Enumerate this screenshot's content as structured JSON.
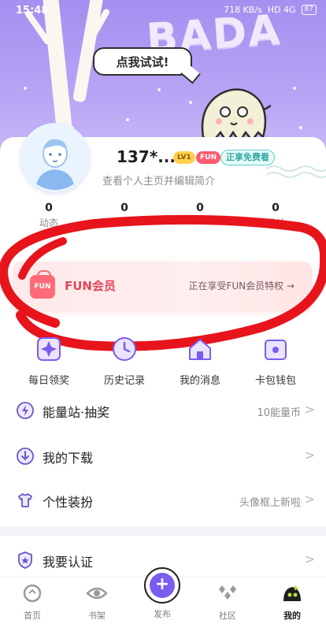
{
  "status_bar": {
    "time": "15:48",
    "net_speed": "718 KB/s",
    "signal": "HD 4G",
    "battery": "87"
  },
  "banner": {
    "bubble_text": "点我试试!",
    "brand_text": "BADA",
    "accent": "#a58ff0"
  },
  "profile": {
    "name": "137*...",
    "level_badge": "LV1",
    "fun_badge": "FUN",
    "free_tag": "正享免费看",
    "subtitle": "查看个人主页并编辑简介"
  },
  "stats": [
    {
      "value": "0",
      "label": "动态"
    },
    {
      "value": "0",
      "label": ""
    },
    {
      "value": "0",
      "label": ""
    },
    {
      "value": "0",
      "label": "粉丝"
    }
  ],
  "member": {
    "logo": "FUN",
    "title": "FUN会员",
    "desc": "正在享受FUN会员特权 →",
    "accent": "#e2465a"
  },
  "quick_actions": [
    {
      "label": "每日领奖",
      "icon": "sparkle-icon"
    },
    {
      "label": "历史记录",
      "icon": "clock-icon"
    },
    {
      "label": "我的消息",
      "icon": "home-message-icon"
    },
    {
      "label": "卡包钱包",
      "icon": "wallet-icon"
    }
  ],
  "menu": [
    {
      "label": "能量站·抽奖",
      "value": "10能量币",
      "icon": "lightning-icon"
    },
    {
      "label": "我的下载",
      "value": "",
      "icon": "download-icon"
    },
    {
      "label": "个性装扮",
      "value": "头像框上新啦",
      "icon": "shirt-icon"
    },
    {
      "label": "我要认证",
      "value": "",
      "icon": "badge-icon"
    }
  ],
  "bottom_nav": [
    {
      "label": "首页",
      "icon": "home-icon"
    },
    {
      "label": "书架",
      "icon": "eye-icon"
    },
    {
      "label": "发布",
      "icon": "plus-icon"
    },
    {
      "label": "社区",
      "icon": "community-icon"
    },
    {
      "label": "我的",
      "icon": "profile-mascot-icon"
    }
  ],
  "chevron": ">"
}
